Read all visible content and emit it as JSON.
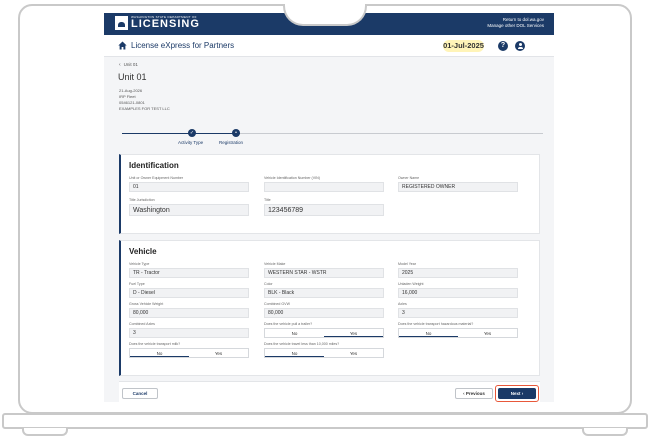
{
  "banner": {
    "logo_small": "WASHINGTON STATE DEPARTMENT OF",
    "logo_big": "LICENSING",
    "link_dol": "Return to dol.wa.gov",
    "link_services": "Manage other DOL Services",
    "background_color": "#1b3a67"
  },
  "header": {
    "home_icon": "home-icon",
    "app_title": "License eXpress for Partners",
    "date": "01-Jul-2025",
    "help_symbol": "?",
    "user_icon": "user-icon"
  },
  "unit": {
    "back_label": "Unit 01",
    "title": "Unit 01",
    "date": "21-Aug-2026",
    "fleet": "IRP Fleet",
    "account": "0546121-0801",
    "company": "EXAMPLES FOR TEST LLC"
  },
  "stepper": {
    "steps": [
      {
        "label": "Activity Type",
        "symbol": "✓"
      },
      {
        "label": "Registration",
        "symbol": "•"
      }
    ]
  },
  "identification": {
    "title": "Identification",
    "unit_number_label": "Unit or Owner Equipment Number",
    "unit_number_value": "01",
    "vin_label": "Vehicle Identification Number (VIN)",
    "vin_value": "",
    "owner_label": "Owner Name",
    "owner_value": "REGISTERED OWNER",
    "title_jurisdiction_label": "Title Jurisdiction",
    "title_jurisdiction_value": "Washington",
    "title_label": "Title",
    "title_value": "123456789"
  },
  "vehicle": {
    "title": "Vehicle",
    "type_label": "Vehicle Type",
    "type_value": "TR - Tractor",
    "make_label": "Vehicle Make",
    "make_value": "WESTERN STAR - WSTR",
    "year_label": "Model Year",
    "year_value": "2025",
    "fuel_label": "Fuel Type",
    "fuel_value": "D - Diesel",
    "color_label": "Color",
    "color_value": "BLK - Black",
    "unladen_label": "Unladen Weight",
    "unladen_value": "16,000",
    "gvw_label": "Gross Vehicle Weight",
    "gvw_value": "80,000",
    "cgvw_label": "Combined GVW",
    "cgvw_value": "80,000",
    "axles_label": "Axles",
    "axles_value": "3",
    "combined_axles_label": "Combined Axles",
    "combined_axles_value": "3",
    "trailer_q": "Does the vehicle pull a trailer?",
    "hazmat_q": "Does the vehicle transport hazardous material?",
    "milk_q": "Does the vehicle transport milk?",
    "miles_q": "Does the vehicle travel less than 10,000 miles?",
    "no_label": "No",
    "yes_label": "Yes",
    "trailer_answer": "Yes",
    "hazmat_answer": "No",
    "milk_answer": "No",
    "miles_answer": "No"
  },
  "footer": {
    "cancel_label": "Cancel",
    "previous_label": "Previous",
    "next_label": "Next",
    "highlight_color": "#e8583a"
  }
}
